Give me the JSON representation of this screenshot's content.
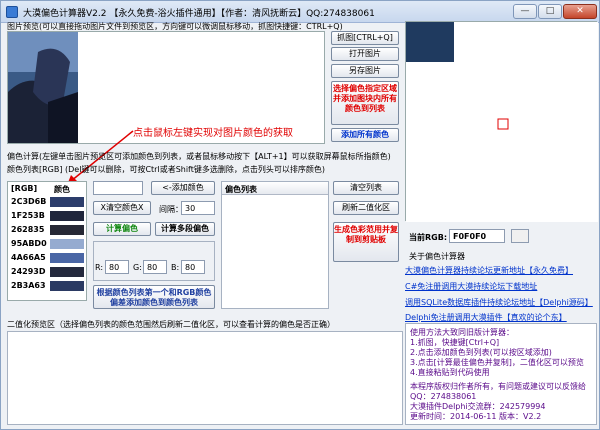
{
  "window": {
    "title": "大漠偏色计算器V2.2 【永久免费-浴火插件通用】【作者：清风抚断云】QQ:274838061",
    "min": "—",
    "max": "□",
    "close": "✕"
  },
  "preview": {
    "label": "图片预览(可以直接拖动图片文件到预览区，方向键可以微调鼠标移动，抓图快捷键：CTRL+Q)"
  },
  "buttons": {
    "capture": "抓图[CTRL+Q]",
    "open": "打开图片",
    "save": "另存图片",
    "select_area": "选择偏色指定区域并添加图块内所有颜色到列表",
    "add_all": "添加所有颜色",
    "add_color": "<-添加颜色",
    "clear_color_x": "X清空颜色X",
    "calc_color": "计算偏色",
    "calc_multi": "计算多段偏色",
    "based_on_first": "根据颜色列表第一个和RGB颜色偏差添加颜色到颜色列表",
    "clear_list": "清空列表",
    "refresh_binary": "刷新二值化区",
    "gen_code": "生成色彩范用并复制到剪贴板"
  },
  "annotation": "点击鼠标左键实现对图片颜色的获取",
  "calc": {
    "label": "偏色计算(左键单击图片预览区可添加颜色到列表，或者鼠标移动按下【ALT+1】可以获取屏幕鼠标所指颜色)",
    "hint": "颜色列表[RGB]  (Del键可以删除，可按Ctrl或者Shift键多选删除，点击列头可以排序颜色)",
    "interval_label": "间隔：",
    "interval_value": "30",
    "r_label": "R:",
    "r_value": "80",
    "g_label": "G:",
    "g_value": "80",
    "b_label": "B:",
    "b_value": "80"
  },
  "color_table": {
    "col_rgb": "[RGB]",
    "col_color": "颜色",
    "rows": [
      {
        "hex": "2C3D6B",
        "color": "#2C3D6B"
      },
      {
        "hex": "1F253B",
        "color": "#1F253B"
      },
      {
        "hex": "262835",
        "color": "#262835"
      },
      {
        "hex": "95ABD0",
        "color": "#95ABD0"
      },
      {
        "hex": "4A66A5",
        "color": "#4A66A5"
      },
      {
        "hex": "24293D",
        "color": "#24293D"
      },
      {
        "hex": "2B3A63",
        "color": "#2B3A63"
      }
    ]
  },
  "color_list": {
    "header": "偏色列表"
  },
  "current": {
    "label": "当前RGB:",
    "value": "F0F0F0"
  },
  "about": {
    "title": "关于偏色计算器",
    "links": [
      "大漠偏色计算器持续论坛更新地址【永久免费】",
      "C#免注册调用大漠持续论坛下载地址",
      "调用SQLite数据库插件持续论坛地址【Delphi源码】",
      "Delphi免注册调用大漠插件【真欢的论个东】"
    ]
  },
  "binary": {
    "label": "二值化预览区（选择偏色列表的颜色范围然后刷新二值化区，可以查看计算的偏色是否正确）"
  },
  "info": {
    "lines": [
      "使用方法大致同旧版计算器：",
      "1.抓图，快捷键[Ctrl+Q]",
      "2.点击添加颜色到列表(可以按区域添加)",
      "3.点击[计算最佳偏色并复制]，二值化区可以预览",
      "4.直接粘贴到代码使用",
      "",
      "本程序版权归作者所有，有问题或建议可以反馈给",
      "QQ：274838061",
      "大漠插件Delphi交流群：242579994",
      "更新时间：2014-06-11 版本：V2.2"
    ]
  },
  "colors": {
    "accent_red": "#e00000",
    "link_blue": "#0033cc",
    "green": "#118811"
  }
}
